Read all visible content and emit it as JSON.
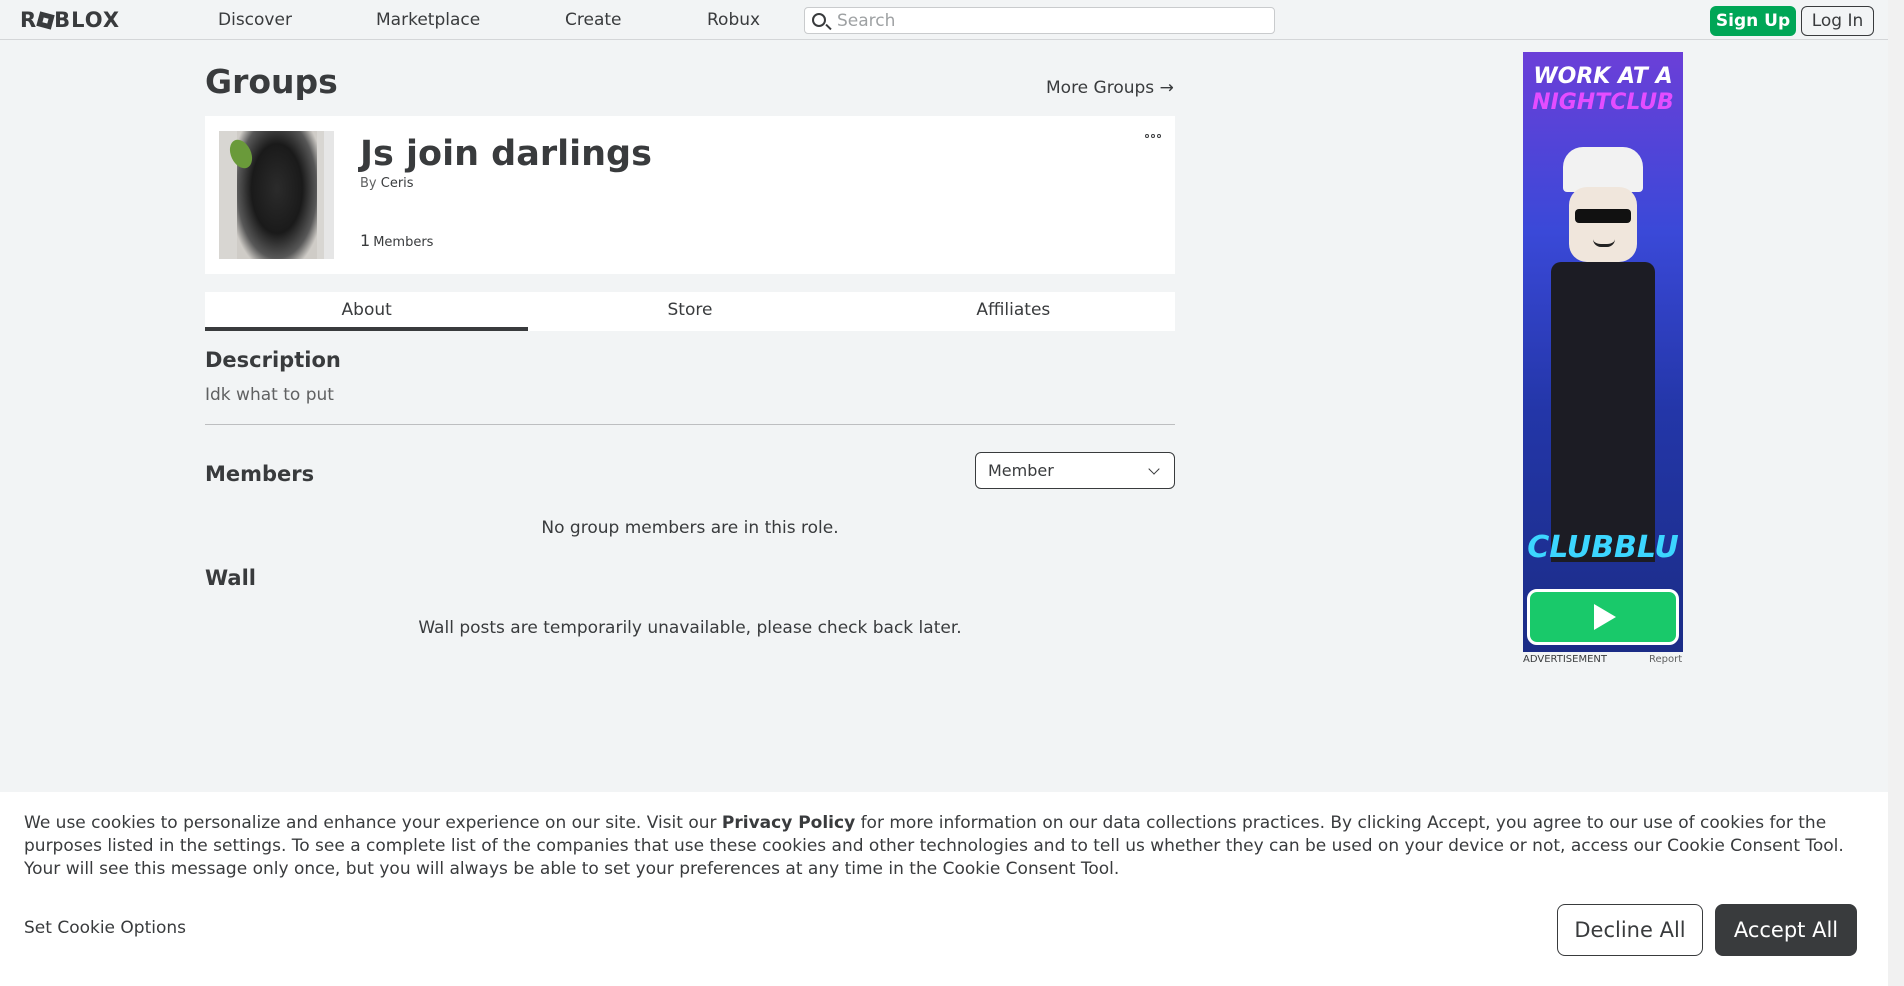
{
  "header": {
    "logo_text_pre": "R",
    "logo_text_post": "BLOX",
    "nav": [
      "Discover",
      "Marketplace",
      "Create",
      "Robux"
    ],
    "search_placeholder": "Search",
    "signup_label": "Sign Up",
    "login_label": "Log In"
  },
  "main": {
    "page_title": "Groups",
    "more_groups_label": "More Groups →",
    "group": {
      "name": "Js join darlings",
      "by_prefix": "By",
      "owner": "Ceris",
      "member_count": "1",
      "member_label": "Members"
    },
    "tabs": [
      "About",
      "Store",
      "Affiliates"
    ],
    "active_tab": "About",
    "description_title": "Description",
    "description_text": "Idk what to put",
    "members_title": "Members",
    "role_select_value": "Member",
    "members_empty": "No group members are in this role.",
    "wall_title": "Wall",
    "wall_empty": "Wall posts are temporarily unavailable, please check back later."
  },
  "ad": {
    "headline_line1": "WORK AT A",
    "headline_line2": "NIGHTCLUB",
    "game_name": "CLUBBLU",
    "advertisement_label": "ADVERTISEMENT",
    "report_label": "Report",
    "accent_pink": "#e44dff",
    "accent_blue": "#3cd6ff",
    "play_green": "#19c96a"
  },
  "cookie_banner": {
    "text_before_link": "We use cookies to personalize and enhance your experience on our site. Visit our ",
    "link_text": "Privacy Policy",
    "text_after_link": " for more information on our data collections practices. By clicking Accept, you agree to our use of cookies for the purposes listed in the settings. To see a complete list of the companies that use these cookies and other technologies and to tell us whether they can be used on your device or not, access our Cookie Consent Tool. Your will see this message only once, but you will always be able to set your preferences at any time in the Cookie Consent Tool.",
    "set_options_label": "Set Cookie Options",
    "decline_label": "Decline All",
    "accept_label": "Accept All"
  },
  "colors": {
    "signup_green": "#00a656",
    "text_primary": "#393b3d",
    "background": "#f2f4f5"
  },
  "icons": {
    "search": "search-icon",
    "more": "more-options-icon",
    "dropdown": "chevron-down-icon",
    "play": "play-icon"
  }
}
